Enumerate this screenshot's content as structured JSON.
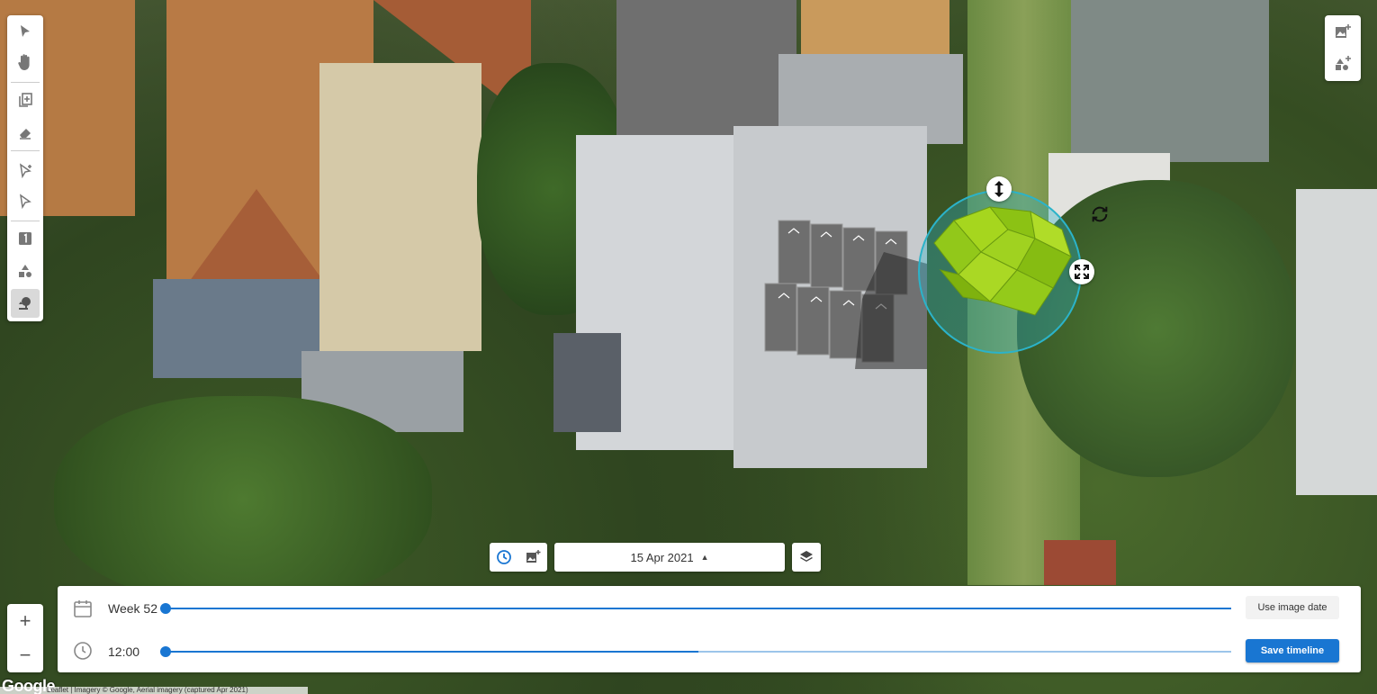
{
  "toolbar": {
    "tools": [
      {
        "name": "select-tool",
        "icon": "cursor-icon"
      },
      {
        "name": "pan-tool",
        "icon": "hand-icon"
      },
      {
        "name": "add-area-tool",
        "icon": "copy-plus-icon"
      },
      {
        "name": "eraser-tool",
        "icon": "eraser-icon"
      },
      {
        "name": "draw-roof-tool",
        "icon": "draw-arrow-icon"
      },
      {
        "name": "edit-roof-tool",
        "icon": "edit-arrow-icon"
      },
      {
        "name": "panel-tool",
        "icon": "panel-number-icon"
      },
      {
        "name": "shapes-tool",
        "icon": "shapes-icon"
      },
      {
        "name": "tree-tool",
        "icon": "tree-icon"
      }
    ],
    "active_tool": "tree-tool"
  },
  "top_right": {
    "tools": [
      "add-image-icon",
      "add-shape-icon"
    ]
  },
  "zoom": {
    "in_label": "+",
    "out_label": "−"
  },
  "date_bar": {
    "date": "15 Apr 2021",
    "chevron": "▲"
  },
  "timeline": {
    "week_label": "Week 52",
    "time_label": "12:00",
    "week_progress": 0.0,
    "time_progress": 0.5,
    "use_image_date_label": "Use image date",
    "save_label": "Save timeline"
  },
  "attribution": {
    "logo": "Google",
    "text": "Leaflet | Imagery © Google, Aerial imagery (captured Apr 2021)"
  },
  "colors": {
    "accent": "#1976d2",
    "track_light": "#9cc5ea",
    "tree_green": "#9ad01a",
    "selection_ring": "#2bb3c9"
  }
}
